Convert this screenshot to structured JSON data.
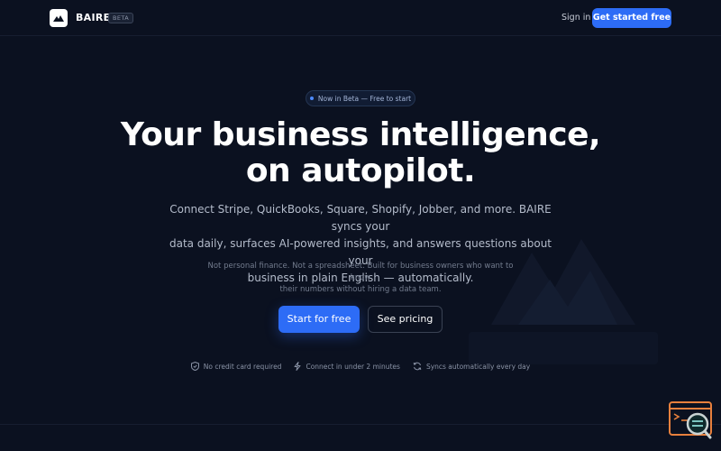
{
  "nav": {
    "brand": "BAIRE",
    "badge": "BETA",
    "sign_in": "Sign in",
    "cta": "Get started free"
  },
  "hero": {
    "beta_badge": "Now in Beta — Free to start",
    "title_line1": "Your business intelligence,",
    "title_line2": "on autopilot.",
    "subtitle_line1": "Connect Stripe, QuickBooks, Square, Shopify, Jobber, and more. BAIRE syncs your",
    "subtitle_line2": "data daily, surfaces AI-powered insights, and answers questions about your",
    "subtitle_line3": "business in plain English — automatically.",
    "note_line1": "Not personal finance. Not a spreadsheet. Built for business owners who want to know",
    "note_line2": "their numbers without hiring a data team.",
    "primary_cta": "Start for free",
    "secondary_cta": "See pricing"
  },
  "features": [
    {
      "icon": "shield-check-icon",
      "label": "No credit card required"
    },
    {
      "icon": "lightning-icon",
      "label": "Connect in under 2 minutes"
    },
    {
      "icon": "refresh-icon",
      "label": "Syncs automatically every day"
    }
  ],
  "colors": {
    "background": "#0b1120",
    "accent": "#2d6cf6",
    "text_primary": "#ffffff",
    "text_secondary": "#b4bccb",
    "text_muted": "#737c8e"
  }
}
